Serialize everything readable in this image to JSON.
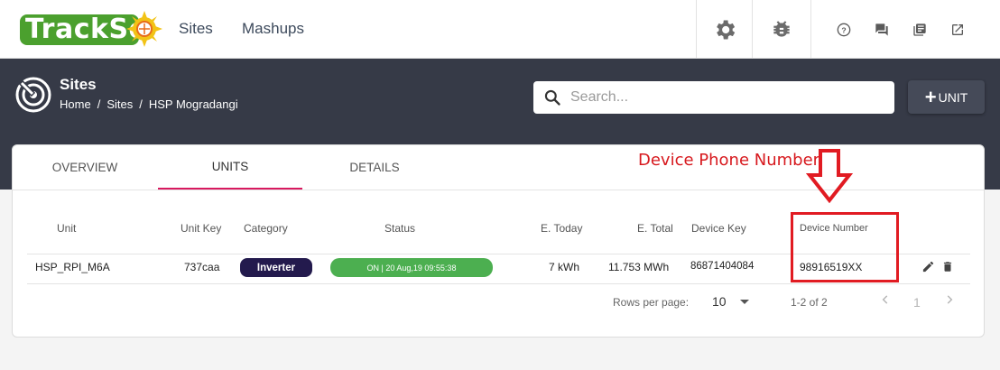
{
  "app": {
    "logo_text": "TrackSo",
    "nav": [
      {
        "label": "Sites"
      },
      {
        "label": "Mashups"
      }
    ],
    "toolbar_icons": [
      "gear-icon",
      "bug-icon",
      "help-icon",
      "chat-icon",
      "docs-icon",
      "external-link-icon"
    ]
  },
  "header": {
    "title": "Sites",
    "breadcrumbs": [
      "Home",
      "Sites",
      "HSP Mogradangi"
    ],
    "search_placeholder": "Search...",
    "add_button_label": "UNIT"
  },
  "tabs": [
    {
      "label": "OVERVIEW",
      "active": false
    },
    {
      "label": "UNITS",
      "active": true
    },
    {
      "label": "DETAILS",
      "active": false
    }
  ],
  "table": {
    "columns": [
      "Unit",
      "Unit Key",
      "Category",
      "Status",
      "E. Today",
      "E. Total",
      "Device Key",
      "Device Number"
    ],
    "rows": [
      {
        "unit": "HSP_RPI_M6A",
        "unit_key": "737caa",
        "category": "Inverter",
        "status": "ON | 20 Aug,19 09:55:38",
        "e_today": "7 kWh",
        "e_total": "11.753 MWh",
        "device_key": "86871404084",
        "device_number": "98916519XX"
      }
    ]
  },
  "pagination": {
    "rows_per_page_label": "Rows per page:",
    "rows_per_page_value": "10",
    "range": "1-2 of 2",
    "page": "1"
  },
  "annotation": {
    "label": "Device Phone Number"
  },
  "colors": {
    "brand_green": "#4ba02e",
    "header_bg": "#363a47",
    "tab_accent": "#d8195f",
    "category_badge": "#231a4d",
    "status_on": "#4caf50",
    "annotation_red": "#e11b22"
  }
}
